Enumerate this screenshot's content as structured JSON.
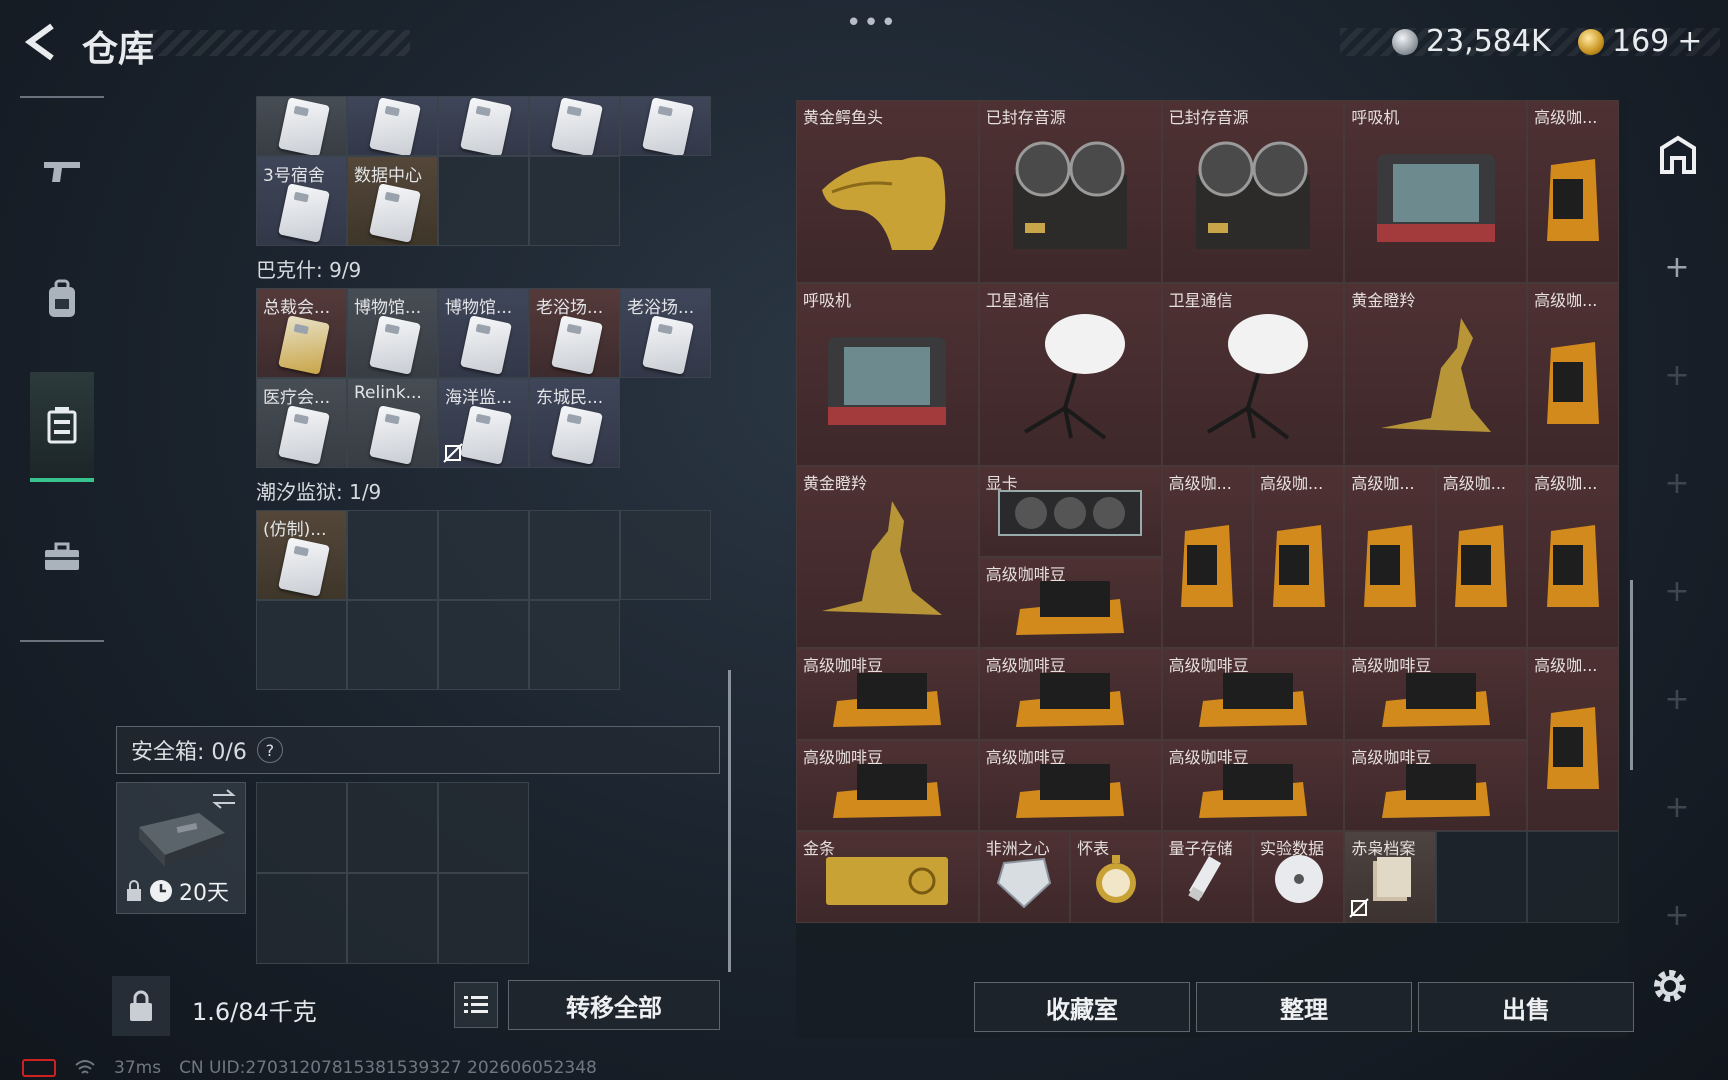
{
  "header": {
    "title": "仓库",
    "top_dots": "•••",
    "currency_silver": "23,584K",
    "currency_gold": "169",
    "currency_gold_plus": "+"
  },
  "nav": {
    "items": [
      "weapon-tab",
      "gear-tab",
      "storage-tab",
      "toolbox-tab"
    ],
    "active": "storage-tab"
  },
  "left": {
    "row_top": [
      "",
      "",
      "",
      "",
      ""
    ],
    "row_keys1": [
      "3号宿舍",
      "数据中心"
    ],
    "section_bakesh": "巴克什: 9/9",
    "bakesh_row1": [
      "总裁会...",
      "博物馆...",
      "博物馆...",
      "老浴场...",
      "老浴场..."
    ],
    "bakesh_row2": [
      "医疗会...",
      "Relink...",
      "海洋监...",
      "东城民..."
    ],
    "section_prison": "潮汐监狱: 1/9",
    "prison_row1": [
      "(仿制)..."
    ],
    "safebox_label": "安全箱: 0/6",
    "safebox_help": "?",
    "case_days": "20天",
    "weight": "1.6/84千克",
    "transfer_all": "转移全部"
  },
  "right": {
    "row1": [
      "黄金鳄鱼头",
      "已封存音源",
      "已封存音源",
      "呼吸机",
      "高级咖..."
    ],
    "row2": [
      "呼吸机",
      "卫星通信",
      "卫星通信",
      "黄金瞪羚",
      "高级咖..."
    ],
    "row3": [
      "黄金瞪羚",
      "显卡",
      "高级咖...",
      "高级咖...",
      "高级咖...",
      "高级咖...",
      "高级咖..."
    ],
    "row3b": "高级咖啡豆",
    "row4": [
      "高级咖啡豆",
      "高级咖啡豆",
      "高级咖啡豆",
      "高级咖啡豆",
      "高级咖..."
    ],
    "row5": [
      "高级咖啡豆",
      "高级咖啡豆",
      "高级咖啡豆",
      "高级咖啡豆"
    ],
    "row6": [
      "金条",
      "非洲之心",
      "怀表",
      "量子存储",
      "实验数据",
      "赤枭档案"
    ],
    "btn_collection": "收藏室",
    "btn_sort": "整理",
    "btn_sell": "出售"
  },
  "status": {
    "ping": "37ms",
    "uid": "CN UID:270312078153815393​27 202606052348"
  },
  "colors": {
    "accent_green": "#37c48f",
    "item_red": "#4e3133"
  }
}
